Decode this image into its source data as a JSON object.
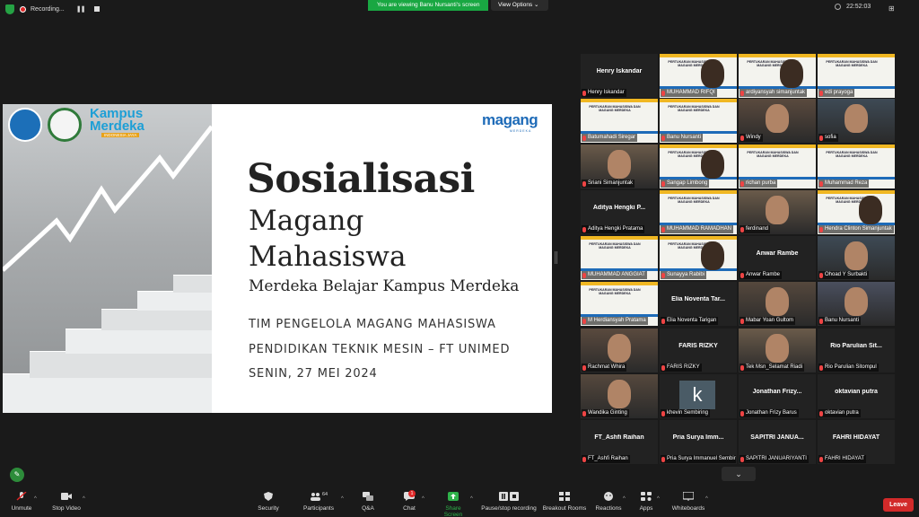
{
  "topbar": {
    "recording_label": "Recording...",
    "viewing_text": "You are viewing Banu Nursanti's screen",
    "view_options_label": "View Options",
    "time": "22:52:03"
  },
  "slide": {
    "logo_text": "Kampus Merdeka",
    "logo_subtext": "INDONESIA JAYA",
    "brand": "magang",
    "brand_sub": "MERDEKA",
    "title": "Sosialisasi",
    "line2": "Magang",
    "line3": "Mahasiswa",
    "subtitle": "Merdeka Belajar Kampus Merdeka",
    "team": "TIM PENGELOLA MAGANG MAHASISWA",
    "dept": "PENDIDIKAN TEKNIK MESIN – FT UNIMED",
    "date": "SENIN, 27 MEI 2024"
  },
  "participants": [
    {
      "label": "Henry Iskandar",
      "big": "Henry Iskandar",
      "kind": "name"
    },
    {
      "label": "MUHAMMAD RIFQI",
      "big": "",
      "kind": "shotcam"
    },
    {
      "label": "ardiyansyah simanjuntak",
      "big": "",
      "kind": "shotcam"
    },
    {
      "label": "edi prayoga",
      "big": "",
      "kind": "shot"
    },
    {
      "label": "Batumahadi Siregar",
      "big": "",
      "kind": "shot"
    },
    {
      "label": "Banu Nursanti",
      "big": "",
      "kind": "shot",
      "active": true
    },
    {
      "label": "Windy",
      "big": "",
      "kind": "cam"
    },
    {
      "label": "sofia",
      "big": "",
      "kind": "cam"
    },
    {
      "label": "Sriani Simanjuntak",
      "big": "",
      "kind": "cam"
    },
    {
      "label": "Sangap Limbong",
      "big": "",
      "kind": "shotcam"
    },
    {
      "label": "richan purba",
      "big": "",
      "kind": "shot"
    },
    {
      "label": "Muhammad Reza",
      "big": "",
      "kind": "shot"
    },
    {
      "label": "Aditya Hengki Pratama",
      "big": "Aditya Hengki P...",
      "kind": "name"
    },
    {
      "label": "MUHAMMAD RAMADHAN",
      "big": "",
      "kind": "shot"
    },
    {
      "label": "ferdinand",
      "big": "",
      "kind": "cam"
    },
    {
      "label": "Hendra Clinton Simanjuntak",
      "big": "",
      "kind": "shotcam"
    },
    {
      "label": "MUHAMMAD ANGGIAT",
      "big": "",
      "kind": "shot"
    },
    {
      "label": "Sunayya Rabibi",
      "big": "",
      "kind": "shotcam"
    },
    {
      "label": "Anwar Rambe",
      "big": "Anwar Rambe",
      "kind": "name"
    },
    {
      "label": "Ohoad Y Surbakti",
      "big": "",
      "kind": "cam"
    },
    {
      "label": "M Herdiansyah Pratama",
      "big": "",
      "kind": "shot"
    },
    {
      "label": "Elia Noventa Tarigan",
      "big": "Elia Noventa Tar...",
      "kind": "name"
    },
    {
      "label": "Mabar Yoan Gultom",
      "big": "",
      "kind": "cam"
    },
    {
      "label": "Banu Nursanti",
      "big": "",
      "kind": "cam"
    },
    {
      "label": "Rachmat Whira",
      "big": "",
      "kind": "cam"
    },
    {
      "label": "FARIS RIZKY",
      "big": "FARIS RIZKY",
      "kind": "name"
    },
    {
      "label": "Tek Msn_Selamat Riadi",
      "big": "",
      "kind": "cam"
    },
    {
      "label": "Rio Parulian Sitompul",
      "big": "Rio Parulian Sit...",
      "kind": "name"
    },
    {
      "label": "Wandika Ginting",
      "big": "",
      "kind": "cam"
    },
    {
      "label": "khevin Sembiring",
      "big": "k",
      "kind": "avatar"
    },
    {
      "label": "Jonathan Frizy Barus",
      "big": "Jonathan Frizy...",
      "kind": "name"
    },
    {
      "label": "oktavian putra",
      "big": "oktavian putra",
      "kind": "name"
    },
    {
      "label": "FT_Ashfi Raihan",
      "big": "FT_Ashfi Raihan",
      "kind": "name"
    },
    {
      "label": "Pria Surya Immanuel Sembiring",
      "big": "Pria Surya Imm...",
      "kind": "name"
    },
    {
      "label": "SAPITRI JANUARIYANTI",
      "big": "SAPITRI JANUA...",
      "kind": "name"
    },
    {
      "label": "FAHRI HIDAYAT",
      "big": "FAHRI HIDAYAT",
      "kind": "name"
    }
  ],
  "shot_title": "PERTUKARAN MAHASISWA DAN MAGANG MERDEKA",
  "toolbar": {
    "unmute": "Unmute",
    "stop_video": "Stop Video",
    "security": "Security",
    "participants": "Participants",
    "participants_count": "64",
    "qa": "Q&A",
    "chat": "Chat",
    "chat_badge": "1",
    "share_screen": "Share Screen",
    "pause_recording": "Pause/stop recording",
    "breakout": "Breakout Rooms",
    "reactions": "Reactions",
    "apps": "Apps",
    "whiteboards": "Whiteboards",
    "leave": "Leave"
  },
  "colors": {
    "accent_green": "#2fb24a",
    "leave_red": "#d22a2a",
    "brand_blue": "#1e6bb8",
    "shot_yellow": "#f0b722"
  }
}
